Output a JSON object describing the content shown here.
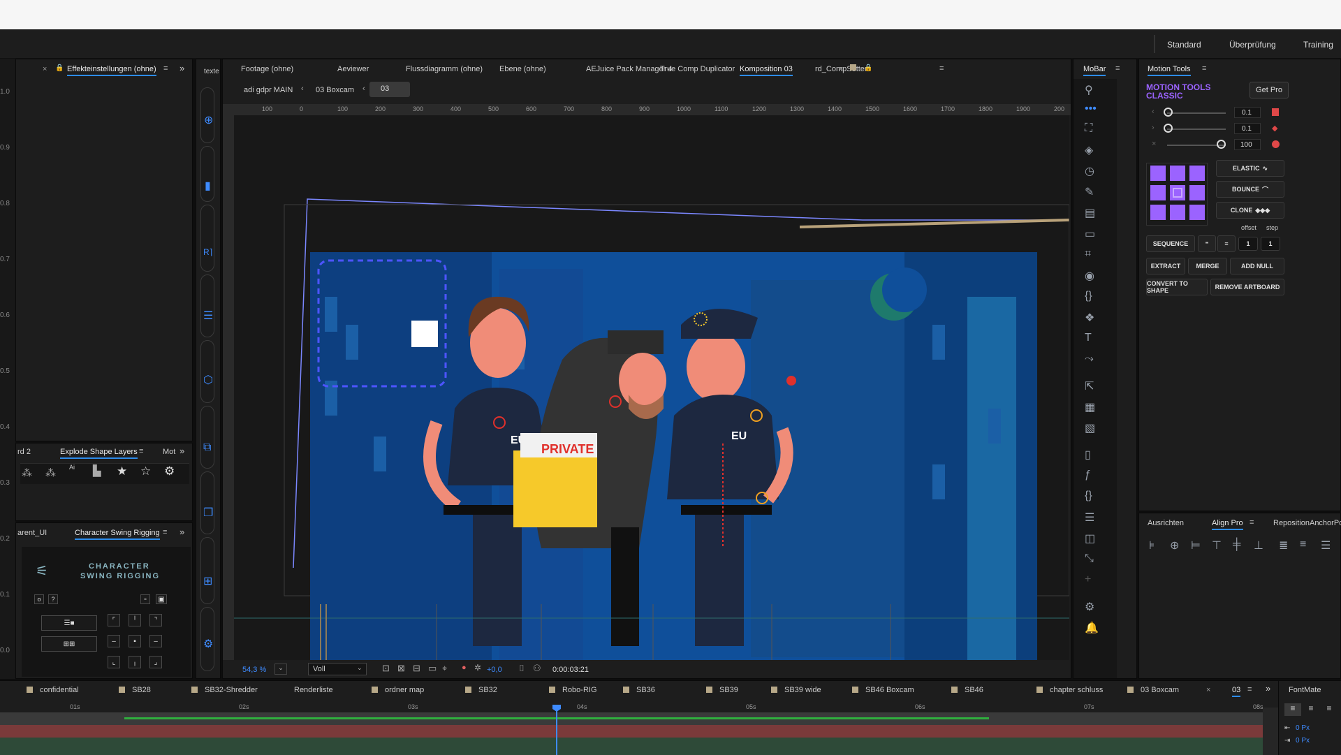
{
  "workspace": {
    "standard": "Standard",
    "review": "Überprüfung",
    "training": "Training"
  },
  "effects_panel": {
    "tab": "Effekteinstellungen (ohne)"
  },
  "left_scale": [
    "1.0",
    "0.9",
    "0.8",
    "0.7",
    "0.6",
    "0.5",
    "0.4",
    "0.3",
    "0.2",
    "0.1",
    "0.0"
  ],
  "explode_panel": {
    "tab_prev": "rd 2",
    "tab": "Explode Shape Layers",
    "tab_next": "Mot",
    "ai_label": "Ai"
  },
  "swing_panel": {
    "tab_prev": "arent_UI",
    "tab": "Character Swing Rigging",
    "title_line1": "CHARACTER",
    "title_line2": "SWING RIGGING",
    "btn_o": "o",
    "btn_q": "?"
  },
  "narrow_panel": {
    "tab": "texte"
  },
  "viewer_tabs": [
    "Footage (ohne)",
    "Aeviewer",
    "Flussdiagramm (ohne)",
    "Ebene (ohne)",
    "AEJuice Pack Manager 4",
    "True Comp Duplicator",
    "Komposition 03",
    "rd_CompSetter"
  ],
  "breadcrumb": {
    "main": "adi gdpr MAIN",
    "boxcam": "03 Boxcam",
    "current": "03"
  },
  "ruler_ticks": [
    "100",
    "0",
    "100",
    "200",
    "300",
    "400",
    "500",
    "600",
    "700",
    "800",
    "900",
    "1000",
    "1100",
    "1200",
    "1300",
    "1400",
    "1500",
    "1600",
    "1700",
    "1800",
    "1900",
    "200"
  ],
  "viewer_bottom": {
    "zoom": "54,3 %",
    "quality": "Voll",
    "exposure": "+0,0",
    "timecode": "0:00:03:21"
  },
  "scene_text": {
    "eu": "EU",
    "private": "PRIVATE"
  },
  "mobar": {
    "tab": "MoBar"
  },
  "motion_tools": {
    "tab": "Motion Tools",
    "brand_line1": "MOTION TOOLS",
    "brand_line2": "CLASSIC",
    "get_pro": "Get Pro",
    "slider1": "0.1",
    "slider2": "0.1",
    "slider3": "100",
    "elastic": "ELASTIC",
    "bounce": "BOUNCE",
    "clone": "CLONE",
    "offset_label": "offset",
    "step_label": "step",
    "sequence": "SEQUENCE",
    "offset_value": "1",
    "step_value": "1",
    "extract": "EXTRACT",
    "merge": "MERGE",
    "add_null": "ADD NULL",
    "convert_to_shape": "CONVERT TO SHAPE",
    "remove_artboard": "REMOVE ARTBOARD",
    "accent": "#9b63ff"
  },
  "align_panel": {
    "tab1": "Ausrichten",
    "tab2": "Align Pro",
    "tab3": "RepositionAnchorPo"
  },
  "comp_tabs": [
    "confidential",
    "SB28",
    "SB32-Shredder",
    "Renderliste",
    "ordner map",
    "SB32",
    "Robo-RIG",
    "SB36",
    "SB39",
    "SB39 wide",
    "SB46 Boxcam",
    "SB46",
    "chapter schluss",
    "03 Boxcam",
    "03"
  ],
  "timeline": {
    "ticks": [
      "01s",
      "02s",
      "03s",
      "04s",
      "05s",
      "06s",
      "07s",
      "08s"
    ]
  },
  "fontmate": {
    "tab": "FontMate",
    "px1": "0 Px",
    "px2": "0 Px"
  }
}
